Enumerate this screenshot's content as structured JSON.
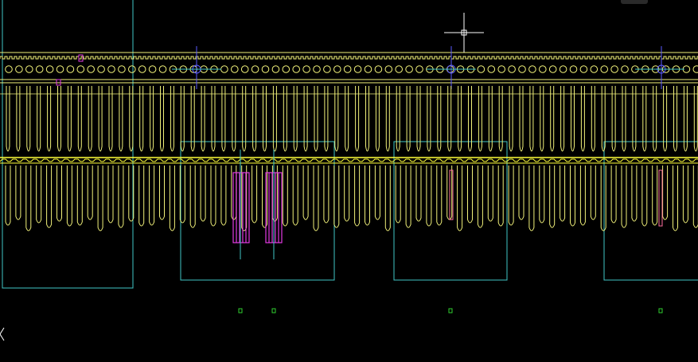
{
  "viewport": {
    "background": "#000000",
    "tool_state": "crosshair-cursor",
    "ucs_icon": "ucs-axis-icon"
  },
  "colors": {
    "yellow": "#f2f27a",
    "yellow_bright": "#ffff3a",
    "cyan": "#3fc6c6",
    "magenta": "#e23ae2",
    "green": "#2fd02f",
    "blue": "#5a5aff",
    "pink": "#ff6f9f",
    "white": "#ffffff"
  },
  "drawing": {
    "comb_repeat_count": 68,
    "hole_row_count": 68
  }
}
